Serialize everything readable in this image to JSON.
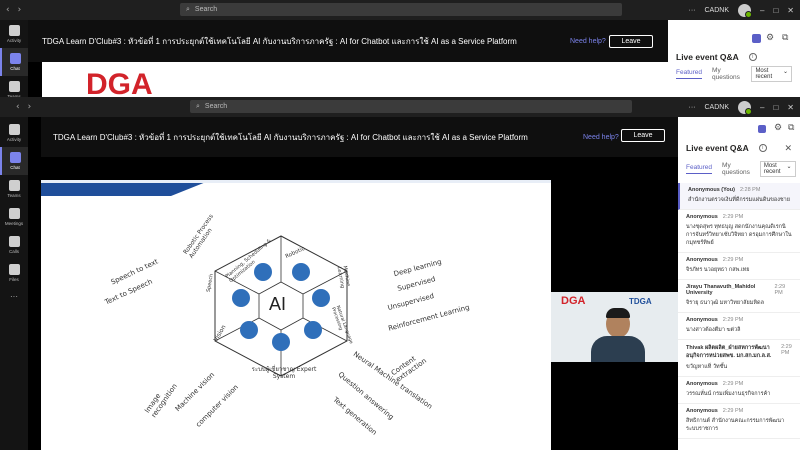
{
  "window": {
    "search_placeholder": "Search",
    "user_initials": "CADNK"
  },
  "rail": [
    {
      "label": "Activity",
      "icon": "bell-icon",
      "active": false
    },
    {
      "label": "Chat",
      "icon": "chat-icon",
      "active": true
    },
    {
      "label": "Teams",
      "icon": "teams-icon",
      "active": false
    },
    {
      "label": "Meetings",
      "icon": "calendar-icon",
      "active": false
    },
    {
      "label": "Calls",
      "icon": "phone-icon",
      "active": false
    },
    {
      "label": "Files",
      "icon": "file-icon",
      "active": false
    }
  ],
  "meeting": {
    "title": "TDGA Learn D'Club#3 : หัวข้อที่ 1 การประยุกต์ใช้เทคโนโลยี AI กับงานบริการภาครัฐ : AI for Chatbot และการใช้ AI as a Service Platform",
    "help_label": "Need help?",
    "leave_label": "Leave"
  },
  "qa": {
    "title": "Live event Q&A",
    "tabs": [
      "Featured",
      "My questions"
    ],
    "sort_label": "Most recent",
    "items": [
      {
        "name": "Anonymous (You)",
        "time": "2:28 PM",
        "text": "สำนักงานตรวจเงินที่ดีกรรมแผ่นดินของชาย",
        "highlight": true
      },
      {
        "name": "Anonymous",
        "time": "2:29 PM",
        "text": "นางชุดสุพร ทุทธบุญ สดกนักงานคุณดิเรกนิการจันทร์วิทยาเซ้บวิจิทยา ดรอุมการศึกษาในกมุทชร์ทิพย์",
        "highlight": false
      },
      {
        "name": "Anonymous",
        "time": "2:29 PM",
        "text": "จิรภัทร นวอยุทธา กสพ.เทย",
        "highlight": false
      },
      {
        "name": "Jirayu Thanavuth_Mahidol University",
        "time": "2:29 PM",
        "text": "จิรายุ ธนาวุฒิ มหาวิทยาลัยมหิดล",
        "highlight": false
      },
      {
        "name": "Anonymous",
        "time": "2:29 PM",
        "text": "นางสาวต้องตีมา ฆต่วลิ",
        "highlight": false
      },
      {
        "name": "Thivak ผลิตผลิต_ฝ่ายสหการพัฒนาอนุกิจการหน่วยสพข. มก.สก.มก.ล.ส.",
        "time": "2:29 PM",
        "text": "ขวัญหาแท็ วัทชั้น",
        "highlight": false
      },
      {
        "name": "Anonymous",
        "time": "2:29 PM",
        "text": "วรรณหั่นน์ กรมเพิ่มงานธุรกิจการค้า",
        "highlight": false
      },
      {
        "name": "Anonymous",
        "time": "2:29 PM",
        "text": "สิทธิกานต์ สำนักงานคณะกรรมการพัฒนาระบบราชการ",
        "highlight": false
      }
    ]
  },
  "slide": {
    "center_label": "AI",
    "segments": [
      "Robotic",
      "Machine Learning",
      "Natural Language Processing",
      "ระบบผู้เชี่ยวชาญ Expert System",
      "Vision",
      "Speech"
    ],
    "annotations": [
      "Robotic Process Automation",
      "Planning, Scheduling & Optimization",
      "Deep learning",
      "Supervised",
      "Unsupervised",
      "Reinforcement Learning",
      "Speech to text",
      "Text to Speech",
      "Image recognition",
      "Machine vision",
      "computer vision",
      "Content extraction",
      "Neural Machine translation",
      "Question answering",
      "Text generation"
    ]
  },
  "video": {
    "banner_left": "DGA",
    "banner_right": "TDGA"
  },
  "colors": {
    "accent": "#5b5fc7",
    "rail_active": "#7b83eb",
    "slide_blue": "#1f4e9a",
    "dga_red": "#d2232a"
  }
}
